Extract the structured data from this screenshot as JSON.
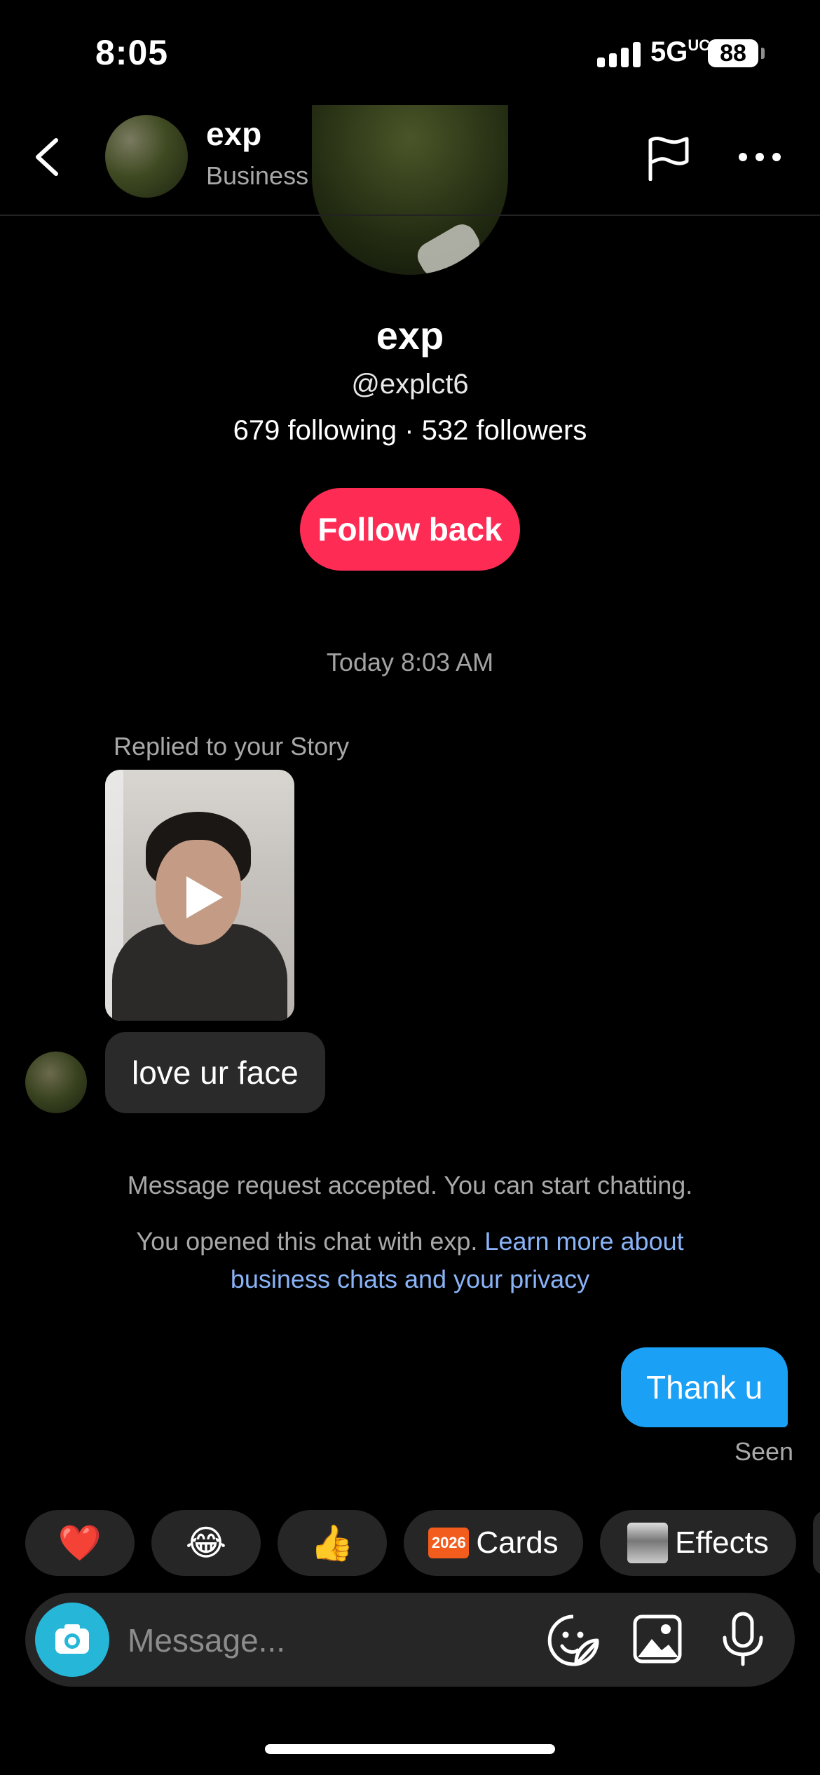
{
  "status_bar": {
    "time": "8:05",
    "network": "5G",
    "network_suffix": "UC",
    "battery": "88"
  },
  "header": {
    "name": "exp",
    "subtitle": "Business chat",
    "back_icon": "chevron-left-icon",
    "report_icon": "flag-icon",
    "more_icon": "more-horizontal-icon"
  },
  "profile": {
    "name": "exp",
    "handle": "@explct6",
    "stats": "679 following · 532 followers",
    "follow_button": "Follow back"
  },
  "chat": {
    "timestamp": "Today 8:03 AM",
    "story_reply_label": "Replied to your Story",
    "incoming_message": "love ur face",
    "system_accepted": "Message request accepted. You can start chatting.",
    "system_opened": "You opened this chat with exp. ",
    "system_link": "Learn more about business chats and your privacy",
    "outgoing_message": "Thank u",
    "seen_label": "Seen"
  },
  "quick_reactions": [
    {
      "emoji": "❤️"
    },
    {
      "emoji": "😂"
    },
    {
      "emoji": "👍"
    },
    {
      "badge": "2026",
      "label": "Cards"
    },
    {
      "label": "Effects"
    }
  ],
  "composer": {
    "placeholder": "Message..."
  },
  "colors": {
    "follow": "#fe2c55",
    "outgoing_bubble": "#1aa0f5",
    "camera": "#25b6d8",
    "link": "#8ab4f8"
  }
}
